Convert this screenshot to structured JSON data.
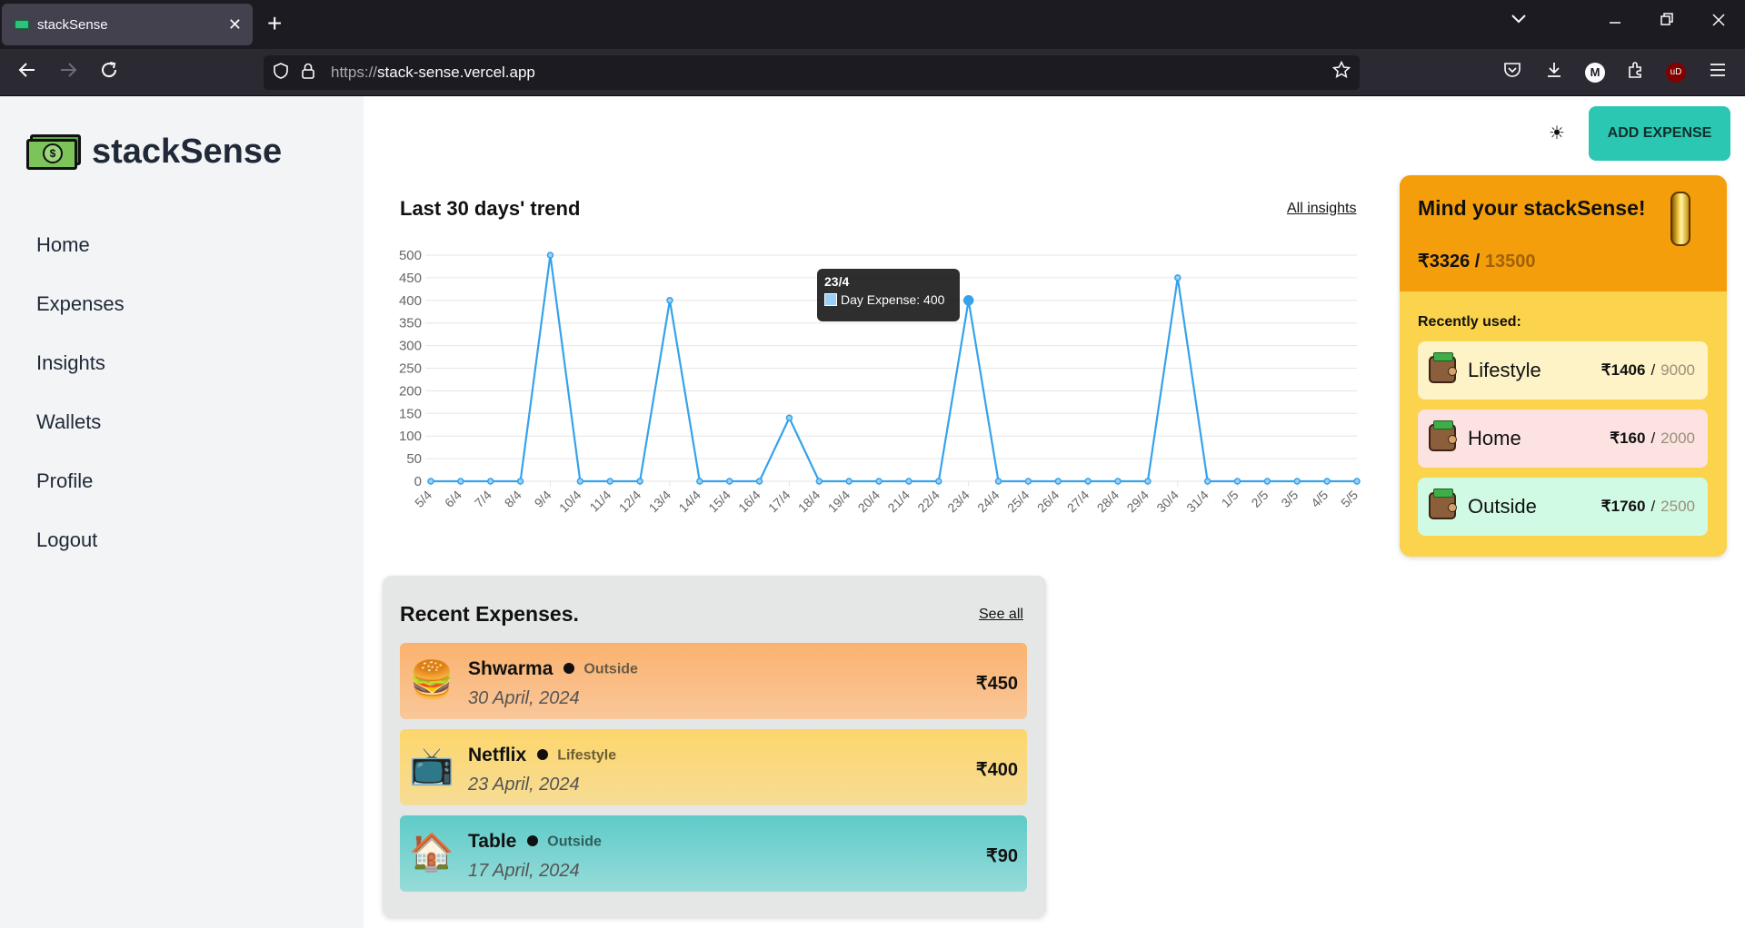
{
  "browser": {
    "tab_title": "stackSense",
    "tab_close": "✕",
    "new_tab": "+",
    "url_protocol": "https://",
    "url_host": "stack-sense.vercel.app",
    "icons": [
      "back-icon",
      "forward-icon",
      "reload-icon",
      "shield-icon",
      "lock-icon",
      "star-icon",
      "pocket-icon",
      "download-icon",
      "account-icon",
      "extensions-icon",
      "ublock-icon",
      "menu-icon"
    ],
    "account_initial": "M",
    "ublock_label": "uD"
  },
  "app": {
    "brand": "stackSense",
    "theme_toggle": "☀",
    "add_expense": "ADD EXPENSE"
  },
  "sidebar": {
    "items": [
      {
        "label": "Home"
      },
      {
        "label": "Expenses"
      },
      {
        "label": "Insights"
      },
      {
        "label": "Wallets"
      },
      {
        "label": "Profile"
      },
      {
        "label": "Logout"
      }
    ]
  },
  "trend": {
    "title": "Last 30 days' trend",
    "link": "All insights",
    "tooltip": {
      "date": "23/4",
      "label": "Day Expense: 400"
    }
  },
  "chart_data": {
    "type": "line",
    "x": [
      "5/4",
      "6/4",
      "7/4",
      "8/4",
      "9/4",
      "10/4",
      "11/4",
      "12/4",
      "13/4",
      "14/4",
      "15/4",
      "16/4",
      "17/4",
      "18/4",
      "19/4",
      "20/4",
      "21/4",
      "22/4",
      "23/4",
      "24/4",
      "25/4",
      "26/4",
      "27/4",
      "28/4",
      "29/4",
      "30/4",
      "31/4",
      "1/5",
      "2/5",
      "3/5",
      "4/5",
      "5/5"
    ],
    "series": [
      {
        "name": "Day Expense",
        "values": [
          0,
          0,
          0,
          0,
          500,
          0,
          0,
          0,
          400,
          0,
          0,
          0,
          140,
          0,
          0,
          0,
          0,
          0,
          400,
          0,
          0,
          0,
          0,
          0,
          0,
          450,
          0,
          0,
          0,
          0,
          0,
          0
        ]
      }
    ],
    "ylim": [
      0,
      500
    ],
    "yticks": [
      0,
      50,
      100,
      150,
      200,
      250,
      300,
      350,
      400,
      450,
      500
    ],
    "grid": true,
    "color": "#36a2eb"
  },
  "recent": {
    "title": "Recent Expenses.",
    "link": "See all",
    "items": [
      {
        "name": "Shwarma",
        "category": "Outside",
        "date": "30 April, 2024",
        "amount": "₹450",
        "icon": "fast-food-icon",
        "glyph": "🍔"
      },
      {
        "name": "Netflix",
        "category": "Lifestyle",
        "date": "23 April, 2024",
        "amount": "₹400",
        "icon": "tv-popcorn-icon",
        "glyph": "📺"
      },
      {
        "name": "Table",
        "category": "Outside",
        "date": "17 April, 2024",
        "amount": "₹90",
        "icon": "home-repair-icon",
        "glyph": "🏠"
      }
    ]
  },
  "budget": {
    "title": "Mind your stackSense!",
    "spent": "₹3326",
    "slash": "/",
    "limit": "13500",
    "recent_label": "Recently used:",
    "wallets": [
      {
        "name": "Lifestyle",
        "spent": "₹1406",
        "sep": "/",
        "limit": "9000"
      },
      {
        "name": "Home",
        "spent": "₹160",
        "sep": "/",
        "limit": "2000"
      },
      {
        "name": "Outside",
        "spent": "₹1760",
        "sep": "/",
        "limit": "2500"
      }
    ]
  }
}
